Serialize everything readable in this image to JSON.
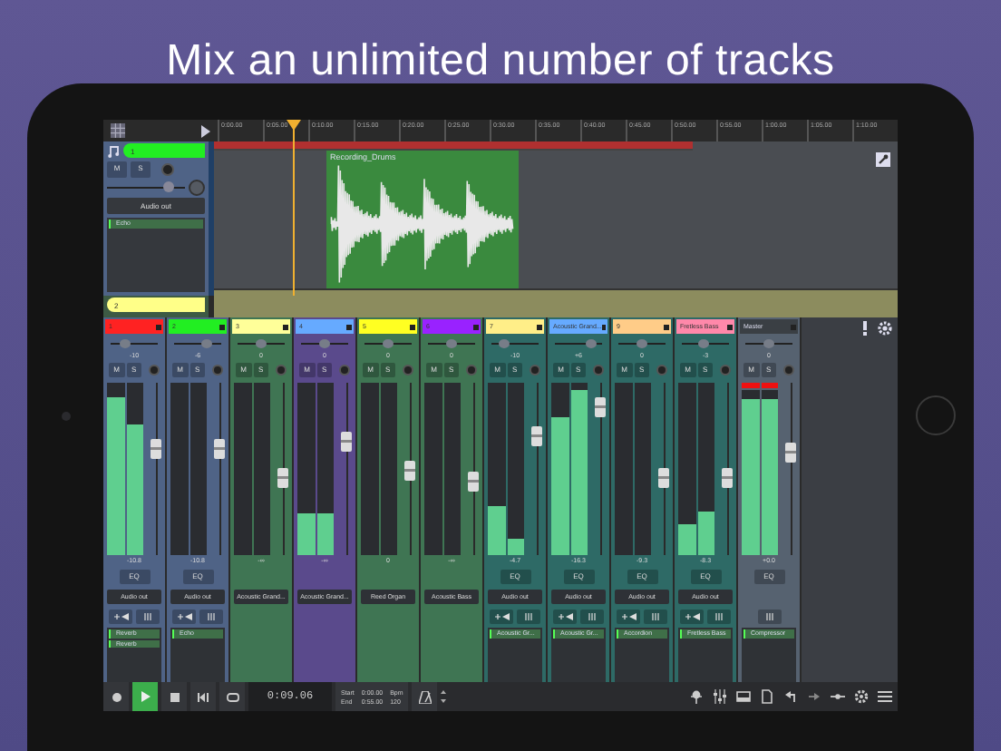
{
  "headline": "Mix an unlimited number of tracks",
  "ruler": [
    "0:00.00",
    "0:05.00",
    "0:10.00",
    "0:15.00",
    "0:20.00",
    "0:25.00",
    "0:30.00",
    "0:35.00",
    "0:40.00",
    "0:45.00",
    "0:50.00",
    "0:55.00",
    "1:00.00",
    "1:05.00",
    "1:10.00"
  ],
  "tracks": [
    {
      "number": "1",
      "color": "#22ee22",
      "mute": "M",
      "solo": "S",
      "volume": {
        "level": 0.78
      },
      "output": "Audio out",
      "effects": [
        "Echo"
      ],
      "clip": {
        "label": "Recording_Drums"
      }
    },
    {
      "number": "2",
      "color": "#ffff88"
    }
  ],
  "strips": [
    {
      "kind": "audio",
      "label": "1",
      "color": "#ff2222",
      "selected": false,
      "pan": {
        "level": 0.3
      },
      "pan_readout": "-10",
      "mute": "M",
      "solo": "S",
      "meters": [
        {
          "level": 0.92
        },
        {
          "level": 0.76
        }
      ],
      "fader": {
        "level": 0.62
      },
      "readout": "-10.8",
      "eq": "EQ",
      "output": "Audio out",
      "fx_buttons": [
        {
          "kind": "insert"
        },
        {
          "kind": "eq"
        }
      ],
      "effects": [
        "Reverb",
        "Reverb"
      ]
    },
    {
      "kind": "audio",
      "label": "2",
      "color": "#22ee22",
      "selected": false,
      "pan": {
        "level": 0.7
      },
      "pan_readout": "-6",
      "mute": "M",
      "solo": "S",
      "meters": [
        {
          "level": 0
        },
        {
          "level": 0
        }
      ],
      "fader": {
        "level": 0.62
      },
      "readout": "-10.8",
      "eq": "EQ",
      "output": "Audio out",
      "fx_buttons": [
        {
          "kind": "insert"
        },
        {
          "kind": "eq"
        }
      ],
      "effects": [
        "Echo"
      ]
    },
    {
      "kind": "instrument",
      "label": "3",
      "color": "#ffff99",
      "selected": false,
      "pan": {
        "level": 0.5
      },
      "pan_readout": "0",
      "mute": "M",
      "solo": "S",
      "meters": [
        {
          "level": 0
        },
        {
          "level": 0
        }
      ],
      "fader": {
        "level": 0.45
      },
      "readout": "-∞",
      "output": "Acoustic Grand..."
    },
    {
      "kind": "instrument",
      "label": "4",
      "color": "#66aaff",
      "selected": true,
      "pan": {
        "level": 0.5
      },
      "pan_readout": "0",
      "mute": "M",
      "solo": "S",
      "meters": [
        {
          "level": 0.24
        },
        {
          "level": 0.24
        }
      ],
      "fader": {
        "level": 0.66
      },
      "readout": "-∞",
      "output": "Acoustic Grand..."
    },
    {
      "kind": "instrument",
      "label": "5",
      "color": "#ffff22",
      "selected": false,
      "pan": {
        "level": 0.5
      },
      "pan_readout": "0",
      "mute": "M",
      "solo": "S",
      "meters": [
        {
          "level": 0
        },
        {
          "level": 0
        }
      ],
      "fader": {
        "level": 0.5
      },
      "readout": "0",
      "output": "Reed Organ"
    },
    {
      "kind": "instrument",
      "label": "6",
      "color": "#9922ff",
      "selected": false,
      "pan": {
        "level": 0.5
      },
      "pan_readout": "0",
      "mute": "M",
      "solo": "S",
      "meters": [
        {
          "level": 0
        },
        {
          "level": 0
        }
      ],
      "fader": {
        "level": 0.43
      },
      "readout": "-∞",
      "output": "Acoustic Bass"
    },
    {
      "kind": "synth",
      "label": "7",
      "color": "#ffee88",
      "selected": false,
      "pan": {
        "level": 0.25
      },
      "pan_readout": "-10",
      "mute": "M",
      "solo": "S",
      "meters": [
        {
          "level": 0.28
        },
        {
          "level": 0.1
        }
      ],
      "fader": {
        "level": 0.7
      },
      "readout": "-4.7",
      "eq": "EQ",
      "output": "Audio out",
      "fx_buttons": [
        {
          "kind": "insert"
        },
        {
          "kind": "eq"
        }
      ],
      "effects": [
        "Acoustic Gr..."
      ]
    },
    {
      "kind": "synth",
      "label": "Acoustic Grand...",
      "color": "#66aaff",
      "selected": false,
      "pan": {
        "level": 0.75
      },
      "pan_readout": "+6",
      "mute": "M",
      "solo": "S",
      "meters": [
        {
          "level": 0.8
        },
        {
          "level": 0.96
        }
      ],
      "fader": {
        "level": 0.86
      },
      "readout": "-16.3",
      "eq": "EQ",
      "output": "Audio out",
      "fx_buttons": [
        {
          "kind": "insert"
        },
        {
          "kind": "eq"
        }
      ],
      "effects": [
        "Acoustic Gr..."
      ]
    },
    {
      "kind": "synth",
      "label": "9",
      "color": "#ffcc88",
      "selected": false,
      "pan": {
        "level": 0.5
      },
      "pan_readout": "0",
      "mute": "M",
      "solo": "S",
      "meters": [
        {
          "level": 0
        },
        {
          "level": 0
        }
      ],
      "fader": {
        "level": 0.45
      },
      "readout": "-9.3",
      "eq": "EQ",
      "output": "Audio out",
      "fx_buttons": [
        {
          "kind": "insert"
        },
        {
          "kind": "eq"
        }
      ],
      "effects": [
        "Accordion"
      ]
    },
    {
      "kind": "synth",
      "label": "Fretless Bass",
      "color": "#ff88aa",
      "selected": false,
      "pan": {
        "level": 0.45
      },
      "pan_readout": "-3",
      "mute": "M",
      "solo": "S",
      "meters": [
        {
          "level": 0.18
        },
        {
          "level": 0.25
        }
      ],
      "fader": {
        "level": 0.45
      },
      "readout": "-8.3",
      "eq": "EQ",
      "output": "Audio out",
      "fx_buttons": [
        {
          "kind": "insert"
        },
        {
          "kind": "eq"
        }
      ],
      "effects": [
        "Fretless Bass"
      ]
    },
    {
      "kind": "master",
      "label": "Master",
      "color": "#3a3f44",
      "selected": false,
      "pan": {
        "level": 0.5
      },
      "pan_readout": "0",
      "mute": "M",
      "solo": "S",
      "clip": true,
      "meters": [
        {
          "level": 0.95
        },
        {
          "level": 0.95
        }
      ],
      "fader": {
        "level": 0.6
      },
      "readout": "+0.0",
      "eq": "EQ",
      "fx_buttons": [
        {
          "kind": "eq"
        }
      ],
      "effects": [
        "Compressor"
      ]
    }
  ],
  "transport": {
    "playing": true,
    "time": "0:09.06",
    "start_label": "Start",
    "start": "0:00.00",
    "end_label": "End",
    "end": "0:55.00",
    "bpm_label": "Bpm",
    "bpm": "120"
  }
}
